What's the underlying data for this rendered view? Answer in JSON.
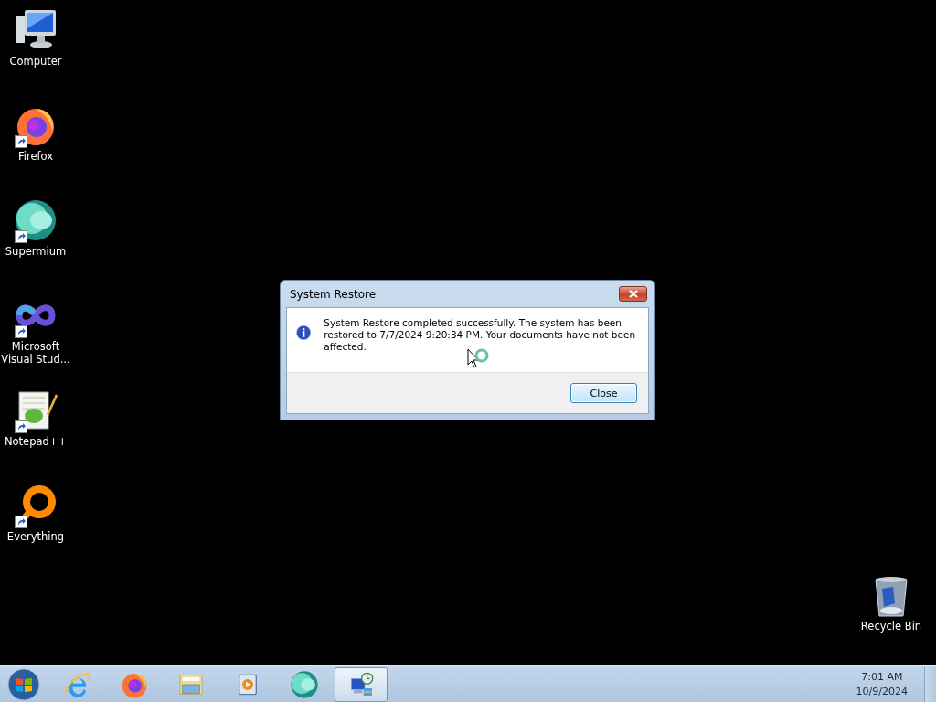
{
  "desktop_icons": [
    {
      "kind": "computer",
      "label": "Computer",
      "shortcut": false
    },
    {
      "kind": "firefox",
      "label": "Firefox",
      "shortcut": true
    },
    {
      "kind": "supermium",
      "label": "Supermium",
      "shortcut": true
    },
    {
      "kind": "visualstudio",
      "label": "Microsoft Visual Stud...",
      "shortcut": true
    },
    {
      "kind": "notepad",
      "label": "Notepad++",
      "shortcut": true
    },
    {
      "kind": "everything",
      "label": "Everything",
      "shortcut": true
    }
  ],
  "recycle_bin": {
    "label": "Recycle Bin"
  },
  "dialog": {
    "title": "System Restore",
    "message": "System Restore completed successfully. The system has been restored to 7/7/2024 9:20:34 PM. Your documents have not been affected.",
    "button": "Close"
  },
  "taskbar": {
    "items": [
      {
        "kind": "ie",
        "selected": false
      },
      {
        "kind": "firefox",
        "selected": false
      },
      {
        "kind": "explorer",
        "selected": false
      },
      {
        "kind": "media",
        "selected": false
      },
      {
        "kind": "supermium",
        "selected": false
      },
      {
        "kind": "restore",
        "selected": true
      }
    ],
    "time": "7:01 AM",
    "date": "10/9/2024"
  }
}
